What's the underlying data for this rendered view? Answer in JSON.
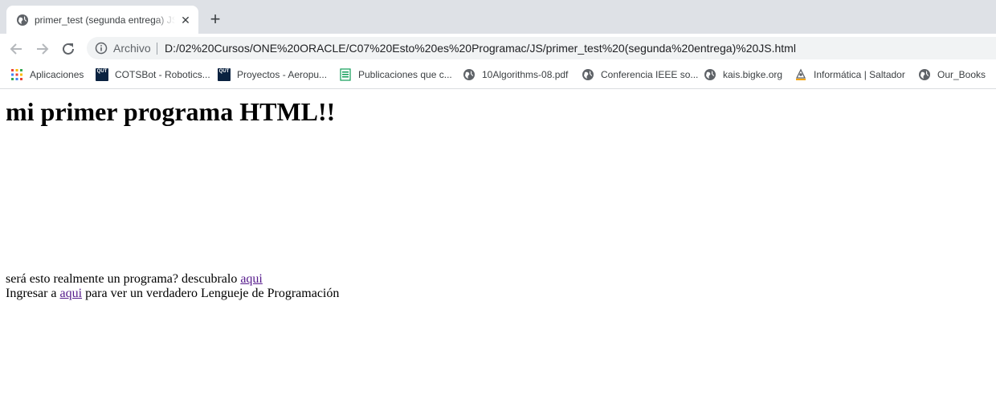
{
  "tab": {
    "title": "primer_test (segunda entrega) JS.html",
    "close_glyph": "✕",
    "new_tab_glyph": "+"
  },
  "toolbar": {
    "scheme_label": "Archivo",
    "url": "D:/02%20Cursos/ONE%20ORACLE/C07%20Esto%20es%20Programac/JS/primer_test%20(segunda%20entrega)%20JS.html"
  },
  "bookmarks": [
    {
      "label": "Aplicaciones",
      "icon": "apps-grid-icon"
    },
    {
      "label": "COTSBot - Robotics...",
      "icon": "qut-logo-icon"
    },
    {
      "label": "Proyectos - Aeropu...",
      "icon": "qut-logo-icon"
    },
    {
      "label": "Publicaciones que c...",
      "icon": "sheet-icon"
    },
    {
      "label": "10Algorithms-08.pdf",
      "icon": "globe-icon"
    },
    {
      "label": "Conferencia IEEE so...",
      "icon": "globe-icon"
    },
    {
      "label": "kais.bigke.org",
      "icon": "globe-icon"
    },
    {
      "label": "Informática | Saltador",
      "icon": "saltador-icon"
    },
    {
      "label": "Our_Books",
      "icon": "globe-icon"
    }
  ],
  "qut_logo_text": "QUT",
  "colors": {
    "tabstrip": "#dee1e6",
    "omnibox": "#f1f3f4",
    "visited_link": "#551a8b",
    "qut_navy": "#0a2240"
  },
  "page": {
    "heading": "mi primer programa HTML!!",
    "line1_text": "será esto realmente un programa? descubralo ",
    "line1_link": "aqui",
    "line2_prefix": "Ingresar a ",
    "line2_link": "aqui",
    "line2_suffix": " para ver un verdadero Lengueje de Programación"
  }
}
